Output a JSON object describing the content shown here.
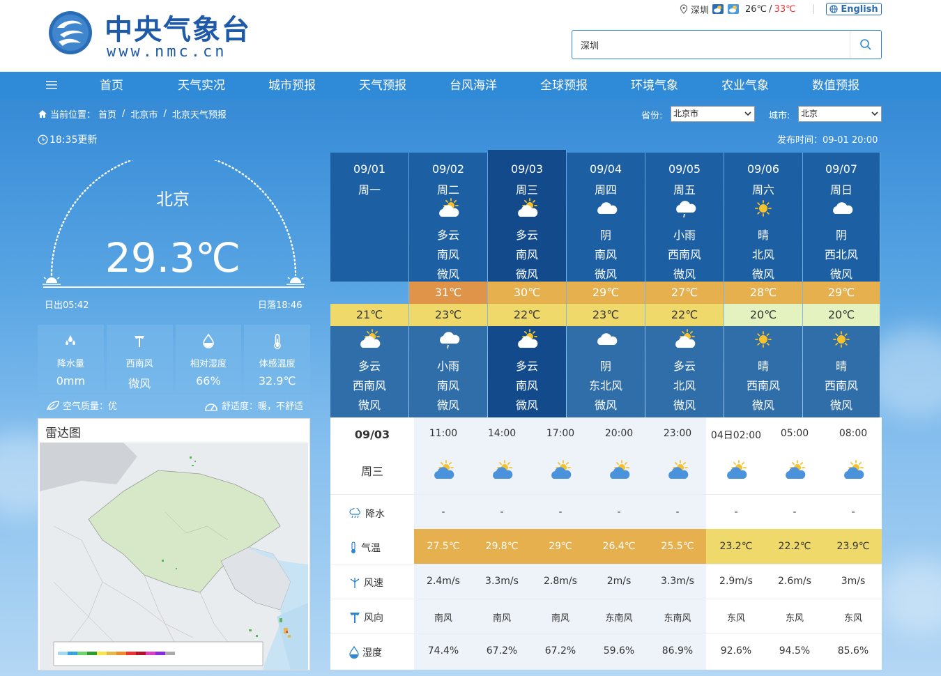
{
  "header": {
    "logo_cn": "中央气象台",
    "logo_en": "www.nmc.cn",
    "loc_city": "深圳",
    "loc_low": "26℃",
    "loc_sep": "/",
    "loc_high": "33℃",
    "english_label": "English",
    "search_value": "深圳"
  },
  "nav": [
    "首页",
    "天气实况",
    "城市预报",
    "天气预报",
    "台风海洋",
    "全球预报",
    "环境气象",
    "农业气象",
    "数值预报"
  ],
  "breadcrumb": {
    "label": "当前位置：",
    "items": [
      "首页",
      "北京市",
      "北京天气预报"
    ],
    "sep": "/"
  },
  "province": {
    "label": "省份:",
    "value": "北京市"
  },
  "city": {
    "label": "城市:",
    "value": "北京"
  },
  "update_time": "18:35更新",
  "publish_time": "发布时间：09-01 20:00",
  "current": {
    "city": "北京",
    "temp": "29.3℃",
    "sunrise": "日出05:42",
    "sunset": "日落18:46",
    "stats": [
      {
        "icon": "raindrops-icon",
        "label": "降水量",
        "value": "0mm"
      },
      {
        "icon": "wind-direction-icon",
        "label": "西南风",
        "value": "微风"
      },
      {
        "icon": "humidity-icon",
        "label": "相对湿度",
        "value": "66%"
      },
      {
        "icon": "thermometer-icon",
        "label": "体感温度",
        "value": "32.9℃"
      }
    ],
    "air_quality": "空气质量：优",
    "comfort": "舒适度：暖，不舒适"
  },
  "radar": {
    "title": "雷达图"
  },
  "days": [
    {
      "date": "09/01",
      "week": "周一",
      "day": null,
      "high": "",
      "low": "21℃",
      "night": {
        "icon": "partly-cloudy-icon",
        "weather": "多云",
        "wind_dir": "西南风",
        "wind": "微风"
      }
    },
    {
      "date": "09/02",
      "week": "周二",
      "day": {
        "icon": "partly-cloudy-icon",
        "weather": "多云",
        "wind_dir": "南风",
        "wind": "微风"
      },
      "high": "31℃",
      "low": "23℃",
      "night": {
        "icon": "light-rain-icon",
        "weather": "小雨",
        "wind_dir": "南风",
        "wind": "微风"
      }
    },
    {
      "date": "09/03",
      "week": "周三",
      "day": {
        "icon": "partly-cloudy-icon",
        "weather": "多云",
        "wind_dir": "南风",
        "wind": "微风"
      },
      "high": "30℃",
      "low": "22℃",
      "night": {
        "icon": "partly-cloudy-icon",
        "weather": "多云",
        "wind_dir": "南风",
        "wind": "微风"
      }
    },
    {
      "date": "09/04",
      "week": "周四",
      "day": {
        "icon": "cloudy-icon",
        "weather": "阴",
        "wind_dir": "南风",
        "wind": "微风"
      },
      "high": "29℃",
      "low": "23℃",
      "night": {
        "icon": "cloudy-icon",
        "weather": "阴",
        "wind_dir": "东北风",
        "wind": "微风"
      }
    },
    {
      "date": "09/05",
      "week": "周五",
      "day": {
        "icon": "light-rain-icon",
        "weather": "小雨",
        "wind_dir": "西南风",
        "wind": "微风"
      },
      "high": "27℃",
      "low": "22℃",
      "night": {
        "icon": "partly-cloudy-icon",
        "weather": "多云",
        "wind_dir": "北风",
        "wind": "微风"
      }
    },
    {
      "date": "09/06",
      "week": "周六",
      "day": {
        "icon": "sunny-icon",
        "weather": "晴",
        "wind_dir": "北风",
        "wind": "微风"
      },
      "high": "28℃",
      "low": "20℃",
      "night": {
        "icon": "sunny-icon",
        "weather": "晴",
        "wind_dir": "西南风",
        "wind": "微风"
      }
    },
    {
      "date": "09/07",
      "week": "周日",
      "day": {
        "icon": "cloudy-icon",
        "weather": "阴",
        "wind_dir": "西北风",
        "wind": "微风"
      },
      "high": "29℃",
      "low": "20℃",
      "night": {
        "icon": "sunny-icon",
        "weather": "晴",
        "wind_dir": "西南风",
        "wind": "微风"
      }
    }
  ],
  "colors": {
    "high_orange": "#df944a",
    "high_amber": "#e6b04e",
    "low_yellow": "#efd96a",
    "low_pale": "#e4f2c0"
  },
  "hourly": {
    "date": "09/03",
    "week": "周三",
    "labels": {
      "precip": "降水",
      "temp": "气温",
      "speed": "风速",
      "dir": "风向",
      "humidity": "湿度"
    },
    "times": [
      "11:00",
      "14:00",
      "17:00",
      "20:00",
      "23:00",
      "04日02:00",
      "05:00",
      "08:00"
    ],
    "precip": [
      "-",
      "-",
      "-",
      "-",
      "-",
      "-",
      "-",
      "-"
    ],
    "temps": [
      "27.5℃",
      "29.8℃",
      "29℃",
      "26.4℃",
      "25.5℃",
      "23.2℃",
      "22.2℃",
      "23.9℃"
    ],
    "speeds": [
      "2.4m/s",
      "3.3m/s",
      "2.8m/s",
      "2m/s",
      "3.3m/s",
      "2.9m/s",
      "2.6m/s",
      "3m/s"
    ],
    "dirs": [
      "南风",
      "南风",
      "南风",
      "东南风",
      "东南风",
      "东风",
      "东风",
      "东风"
    ],
    "humidity": [
      "74.4%",
      "67.2%",
      "67.2%",
      "59.6%",
      "86.9%",
      "92.6%",
      "94.5%",
      "85.6%"
    ]
  }
}
